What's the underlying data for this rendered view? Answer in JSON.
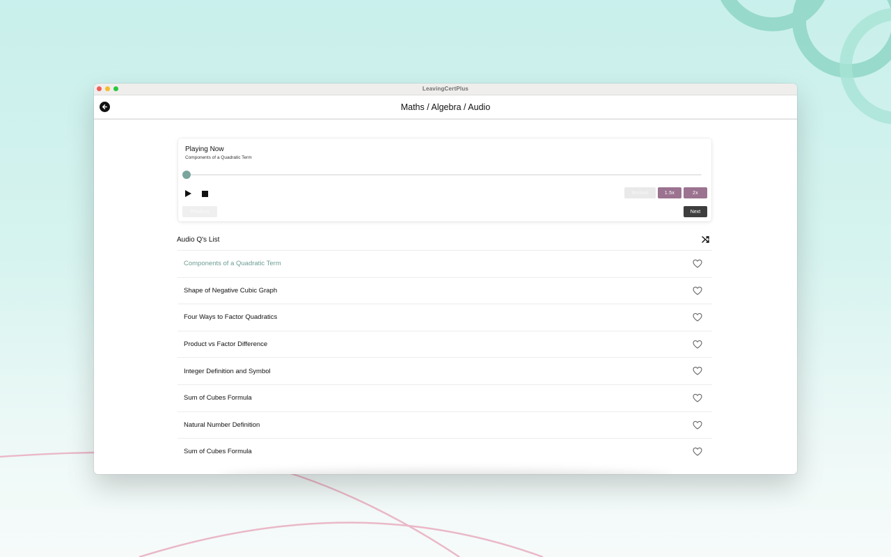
{
  "window": {
    "title": "LeavingCertPlus"
  },
  "header": {
    "breadcrumb": "Maths / Algebra / Audio",
    "back_icon": "arrow-left-icon"
  },
  "player": {
    "heading": "Playing Now",
    "track_title": "Components of a Quadratic Term",
    "progress": 0,
    "speed_options": [
      "Normal",
      "1.5x",
      "2x"
    ],
    "previous_label": "Previous",
    "next_label": "Next",
    "accent_color": "#7aa59d",
    "speed_color": "#9b7290"
  },
  "list": {
    "title": "Audio Q's List",
    "shuffle_icon": "shuffle-icon",
    "items": [
      {
        "label": "Components of a Quadratic Term",
        "active": true
      },
      {
        "label": "Shape of Negative Cubic Graph",
        "active": false
      },
      {
        "label": "Four Ways to Factor Quadratics",
        "active": false
      },
      {
        "label": "Product vs Factor Difference",
        "active": false
      },
      {
        "label": "Integer Definition and Symbol",
        "active": false
      },
      {
        "label": "Sum of Cubes Formula",
        "active": false
      },
      {
        "label": "Natural Number Definition",
        "active": false
      },
      {
        "label": "Sum of Cubes Formula",
        "active": false
      }
    ]
  }
}
